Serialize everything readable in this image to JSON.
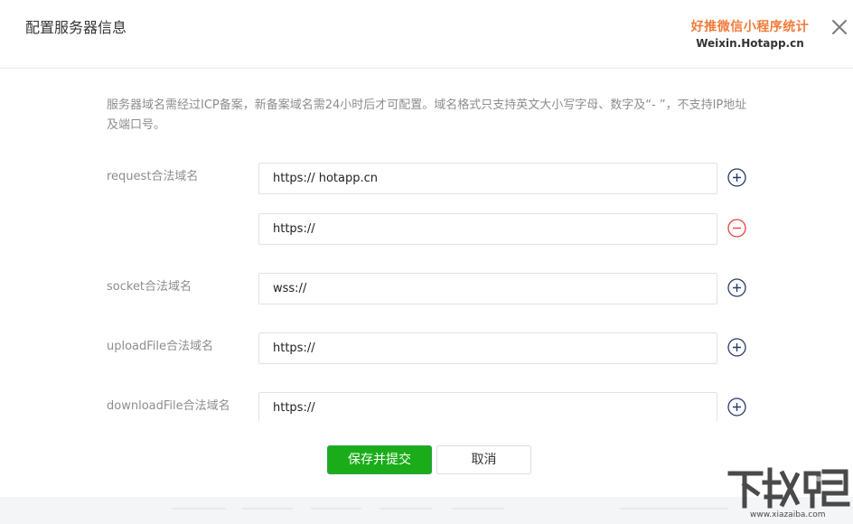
{
  "dialog": {
    "title": "配置服务器信息",
    "brand_cn": "好推微信小程序统计",
    "brand_en": "Weixin.Hotapp.cn",
    "close_icon": "close-icon",
    "description": "服务器域名需经过ICP备案，新备案域名需24小时后才可配置。域名格式只支持英文大小写字母、数字及“- ”，不支持IP地址及端口号。"
  },
  "fields": {
    "request": {
      "label": "request合法域名",
      "value1": "https:// hotapp.cn",
      "value2": "https://",
      "add_icon": "plus-circle-icon",
      "remove_icon": "minus-circle-icon"
    },
    "socket": {
      "label": "socket合法域名",
      "value": "wss://",
      "add_icon": "plus-circle-icon"
    },
    "upload": {
      "label": "uploadFile合法域名",
      "value": "https://",
      "add_icon": "plus-circle-icon"
    },
    "download": {
      "label": "downloadFile合法域名",
      "value": "https://",
      "add_icon": "plus-circle-icon"
    }
  },
  "buttons": {
    "save_submit": "保存并提交",
    "cancel": "取消"
  },
  "colors": {
    "primary": "#1aad19",
    "brand": "#f27b3a",
    "add": "#283a6b",
    "remove": "#e64340"
  },
  "watermark": {
    "site": "www.xiazaiba.com"
  }
}
